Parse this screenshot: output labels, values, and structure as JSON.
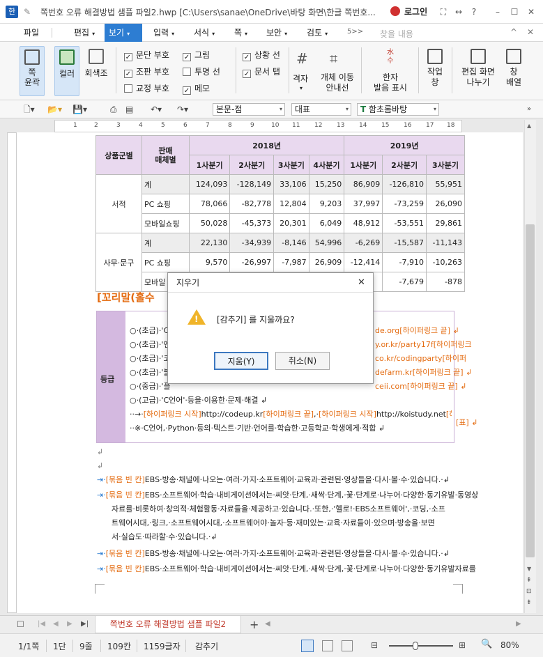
{
  "app": {
    "logo": "한",
    "title": "쪽번호 오류 해결방법 샘플 파일2.hwp [C:\\Users\\sanae\\OneDrive\\바탕 화면\\한글 쪽번호...",
    "login": "로그인",
    "help": "?"
  },
  "menu": {
    "items": [
      "파일",
      "편집",
      "보기",
      "입력",
      "서식",
      "쪽",
      "보안",
      "검토"
    ],
    "active": "보기",
    "search_placeholder": "찾을 내용",
    "more": "5>>"
  },
  "ribbon": {
    "page_outline": "쪽\n윤곽",
    "color": "컬러",
    "grayscale": "회색조",
    "checks": [
      {
        "label": "문단 부호",
        "checked": true
      },
      {
        "label": "그림",
        "checked": true
      },
      {
        "label": "조판 부호",
        "checked": true
      },
      {
        "label": "투명 선",
        "checked": false
      },
      {
        "label": "교정 부호",
        "checked": false
      },
      {
        "label": "메모",
        "checked": true
      },
      {
        "label": "상황 선",
        "checked": true
      },
      {
        "label": "문서 탭",
        "checked": true
      }
    ],
    "grid": "격자",
    "object_move_guide": "개체 이동\n안내선",
    "hanja": "한자\n발음 표시",
    "hanja_glyph": "水\n수",
    "work_window": "작업\n창",
    "split_screen": "편집 화면\n나누기",
    "window": "창\n배열"
  },
  "toolbar": {
    "style": "본문-점",
    "font_face": "대표",
    "font": "함초롬바탕"
  },
  "ruler": {
    "marks": [
      "1",
      "2",
      "3",
      "4",
      "5",
      "6",
      "7",
      "8",
      "9",
      "10",
      "11",
      "12",
      "13",
      "14",
      "15",
      "16",
      "17",
      "18"
    ]
  },
  "table": {
    "header": {
      "group": "상품군별",
      "channel": "판매\n매체별",
      "y2018": "2018년",
      "y2019": "2019년",
      "quarters": [
        "1사분기",
        "2사분기",
        "3사분기",
        "4사분기",
        "1사분기",
        "2사분기",
        "3사분기"
      ]
    },
    "rows": [
      {
        "group": "서적",
        "channel": "계",
        "values": [
          "124,093",
          "-128,149",
          "33,106",
          "15,250",
          "86,909",
          "-126,810",
          "55,951"
        ]
      },
      {
        "group": "",
        "channel": "PC 쇼핑",
        "values": [
          "78,066",
          "-82,778",
          "12,804",
          "9,203",
          "37,997",
          "-73,259",
          "26,090"
        ]
      },
      {
        "group": "",
        "channel": "모바일쇼핑",
        "values": [
          "50,028",
          "-45,373",
          "20,301",
          "6,049",
          "48,912",
          "-53,551",
          "29,861"
        ]
      },
      {
        "group": "사무·문구",
        "channel": "계",
        "values": [
          "22,130",
          "-34,939",
          "-8,146",
          "54,996",
          "-6,269",
          "-15,587",
          "-11,143"
        ]
      },
      {
        "group": "",
        "channel": "PC 쇼핑",
        "values": [
          "9,570",
          "-26,997",
          "-7,987",
          "26,909",
          "-12,414",
          "-7,910",
          "-10,263"
        ]
      },
      {
        "group": "",
        "channel": "모바일",
        "values": [
          "",
          "",
          "",
          "",
          "",
          "-7,679",
          "-878"
        ]
      }
    ]
  },
  "doc": {
    "heading": "[꼬리말(홀수",
    "level_label": "등급",
    "level_lines": [
      "○·(초급)·'C",
      "○·(초급)·'엔",
      "○·(초급)·'코",
      "○·(초급)·'블",
      "○·(중급)·'플",
      "○·(고급)·'C언어'·등을·이용한·문제·해결 ↲"
    ],
    "level_right": [
      "de.org[하이퍼링크 끝] ↲",
      "y.or.kr/party17f[하이퍼링크",
      "co.kr/codingparty[하이퍼",
      "defarm.kr[하이퍼링크 끝] ↲",
      "ceii.com[하이퍼링크 끝] ↲"
    ],
    "link_line_prefix": "··→·",
    "link_start": "[하이퍼링크 시작]",
    "link_url1": "http://codeup.kr",
    "link_end": "[하이퍼링크 끝]",
    "link_url2": "http://koistudy.net",
    "link_tail": "[하이퍼",
    "note_line": "··※·C언어,·Python·등의·텍스트·기반·언어를·학습한·고등학교·학생에게·적합 ↲",
    "table_mark": "[표] ↲",
    "bullet_tag": "[묶음 빈 칸]",
    "p1": "EBS·방송·채널에·나오는·여러·가지·소프트웨어·교육과·관련된·영상들을·다시·볼·수·있습니다.·↲",
    "p2a": "EBS·소프트웨어·학습·내비게이션에서는·씨앗·단계,·새싹·단계,·꽃·단계로·나누어·다양한·동기유발·동영상",
    "p2b": "자료를·비롯하여·창의적·체험활동·자료들을·제공하고·있습니다.·또한,·'헬로!·EBS소프트웨어',·코딩,·소프",
    "p2c": "트웨어시대,·링크,·소프트웨어시대,·소프트웨어야·놀자·등·재미있는·교육·자료들이·있으며·방송을·보면",
    "p2d": "서·실습도·따라할·수·있습니다.·↲",
    "p3": "EBS·방송·채널에·나오는·여러·가지·소프트웨어·교육과·관련된·영상들을·다시·볼·수·있습니다.·↲",
    "p4": "EBS·소프트웨어·학습·내비게이션에서는·씨앗·단계,·새싹·단계,·꽃·단계로·나누어·다양한·동기유발자료를"
  },
  "dialog": {
    "title": "지우기",
    "message": "[감추기] 를 지울까요?",
    "ok": "지움(Y)",
    "cancel": "취소(N)"
  },
  "tabs": {
    "doc_tab": "쪽번호 오류 해결방법 샘플 파일2",
    "add": "+"
  },
  "status": {
    "page": "1/1쪽",
    "section": "1단",
    "line": "9줄",
    "col": "109칸",
    "chars": "1159글자",
    "mode": "감추기",
    "zoom": "80%"
  },
  "colors": {
    "accent": "#2d7dd2",
    "header_fill": "#e9d9ef",
    "link_orange": "#e46b10",
    "level_cell": "#d4b9e0"
  }
}
